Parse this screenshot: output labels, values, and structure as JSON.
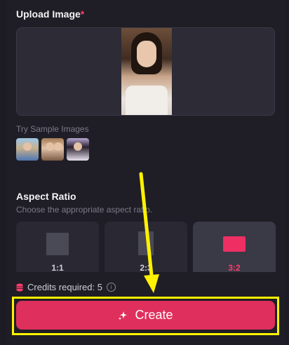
{
  "upload": {
    "title": "Upload Image",
    "required_mark": "*"
  },
  "samples": {
    "label": "Try Sample Images",
    "images": [
      "sample-child",
      "sample-group",
      "sample-woman"
    ]
  },
  "aspect_ratio": {
    "title": "Aspect Ratio",
    "subtitle": "Choose the appropriate aspect ratio.",
    "options": [
      {
        "label": "1:1",
        "selected": false
      },
      {
        "label": "2:3",
        "selected": false
      },
      {
        "label": "3:2",
        "selected": true
      }
    ]
  },
  "credits": {
    "text": "Credits required: 5",
    "info_icon": "i"
  },
  "create": {
    "label": "Create",
    "icon": "sparkle-icon"
  },
  "colors": {
    "accent": "#df2f5c",
    "highlight": "#fff200",
    "background": "#1f1e26"
  }
}
